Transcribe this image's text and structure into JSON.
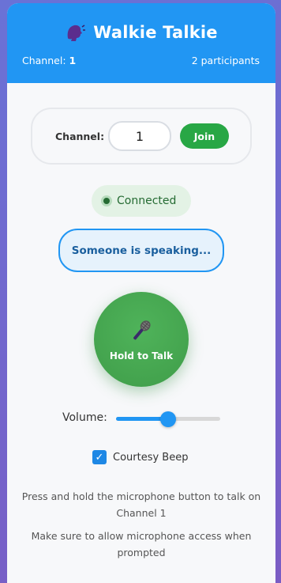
{
  "header": {
    "title": "Walkie Talkie",
    "channel_prefix": "Channel:",
    "channel_number": "1",
    "participants": "2 participants",
    "icon": "speaking-head-icon",
    "accent_color": "#2196f3"
  },
  "channel_form": {
    "label": "Channel:",
    "input_value": "1",
    "join_label": "Join",
    "join_color": "#28a745"
  },
  "status": {
    "label": "Connected",
    "color": "#256b33"
  },
  "speaking_indicator": {
    "text": "Someone is speaking..."
  },
  "talk_button": {
    "label": "Hold to Talk",
    "icon": "microphone-icon"
  },
  "volume": {
    "label": "Volume:",
    "level": 0.5
  },
  "courtesy_beep": {
    "label": "Courtesy Beep",
    "checked": true
  },
  "help": {
    "line1": "Press and hold the microphone button to talk on Channel 1",
    "line2": "Make sure to allow microphone access when prompted"
  }
}
